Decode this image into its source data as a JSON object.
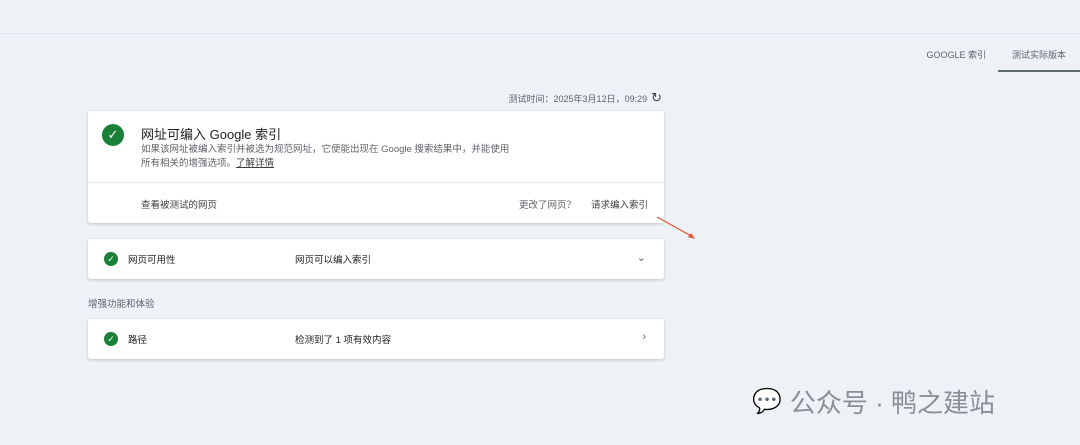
{
  "tabs": [
    "GOOGLE 索引",
    "测试实际版本"
  ],
  "timestamp": "测试时间：2025年3月12日，09:29",
  "result": {
    "title": "网址可编入 Google 索引",
    "desc": "如果该网址被编入索引并被选为规范网址，它便能出现在 Google 搜索结果中，并能使用所有相关的增强选项。",
    "learn_more": "了解详情",
    "view_page": "查看被测试的网页",
    "changed": "更改了网页？",
    "request": "请求编入索引"
  },
  "availability": {
    "label": "网页可用性",
    "value": "网页可以编入索引"
  },
  "section": "增强功能和体验",
  "breadcrumbs": {
    "label": "路径",
    "value": "检测到了 1 项有效内容"
  },
  "watermark": "公众号 · 鸭之建站"
}
